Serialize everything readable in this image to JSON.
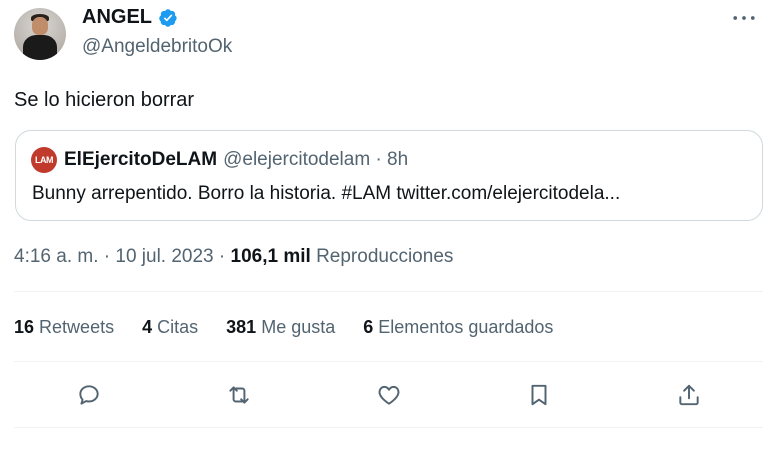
{
  "author": {
    "display_name": "ANGEL",
    "handle": "@AngeldebritoOk",
    "verified_icon": "verified-badge-icon"
  },
  "tweet": {
    "text": "Se lo hicieron borrar"
  },
  "quoted_tweet": {
    "avatar_text": "LAM",
    "name": "ElEjercitoDeLAM",
    "meta": "@elejercitodelam · 8h",
    "text": "Bunny arrepentido. Borro la historia. #LAM twitter.com/elejercitodela..."
  },
  "meta": {
    "time_date": "4:16 a. m. · 10 jul. 2023 · ",
    "views_count": "106,1 mil",
    "views_label": " Reproducciones"
  },
  "stats": [
    {
      "count": "16",
      "label": "Retweets"
    },
    {
      "count": "4",
      "label": "Citas"
    },
    {
      "count": "381",
      "label": "Me gusta"
    },
    {
      "count": "6",
      "label": "Elementos guardados"
    }
  ],
  "actions": [
    "reply-icon",
    "retweet-icon",
    "like-icon",
    "bookmark-icon",
    "share-icon"
  ],
  "colors": {
    "text_primary": "#0f1419",
    "text_secondary": "#536471",
    "verified": "#1d9bf0",
    "border": "#cfd9de",
    "lam_red": "#c0392b"
  }
}
